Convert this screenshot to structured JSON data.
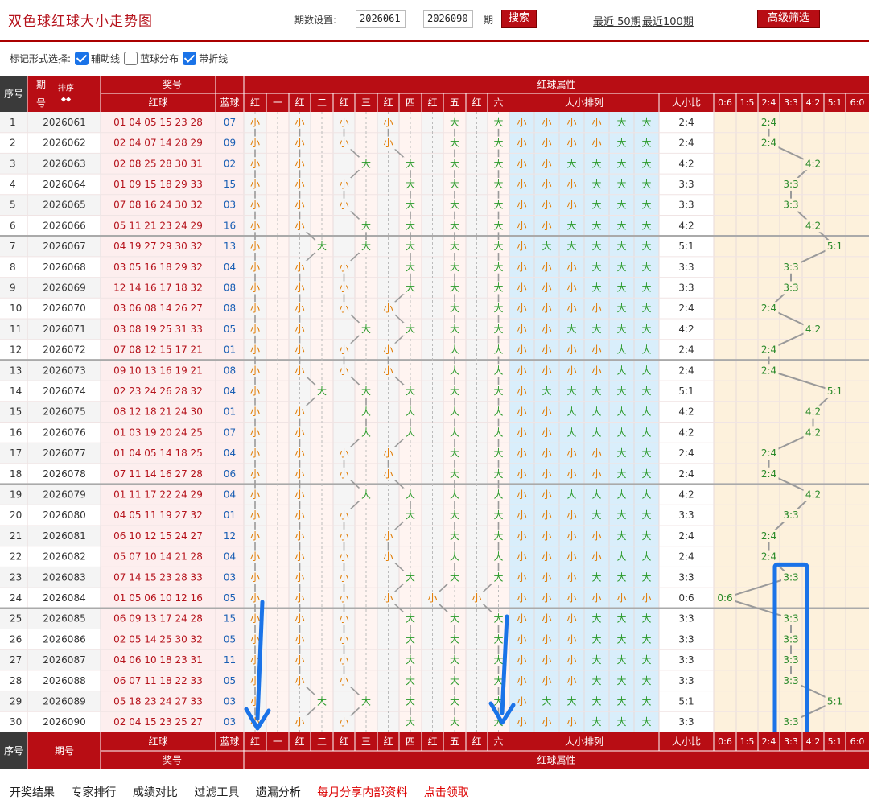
{
  "page_title": "双色球红球大小走势图",
  "controls": {
    "period_label": "期数设置:",
    "start_period": "2026061",
    "separator": "-",
    "end_period": "2026090",
    "period_unit": "期",
    "search_button": "搜索",
    "recent50_link": "最近 50期",
    "recent100_link": "最近100期",
    "advanced_button": "高级筛选"
  },
  "mark_options": {
    "label": "标记形式选择:",
    "options": [
      {
        "label": "辅助线",
        "checked": true
      },
      {
        "label": "蓝球分布",
        "checked": false
      },
      {
        "label": "带折线",
        "checked": true
      }
    ]
  },
  "header": {
    "seq": "序号",
    "period": "期号",
    "period_top": "期",
    "period_bottom": "号",
    "sort_label": "排序",
    "sort_arrows": "◆◆",
    "award": "奖号",
    "red": "红球",
    "blue": "蓝球",
    "red_attr": "红球属性",
    "pos_labels": [
      "红",
      "一",
      "红",
      "二",
      "红",
      "三",
      "红",
      "四",
      "红",
      "五",
      "红",
      "六"
    ],
    "dxpl": "大小排列",
    "ratio": "大小比",
    "ratio_cols": [
      "0:6",
      "1:5",
      "2:4",
      "3:3",
      "4:2",
      "5:1",
      "6:0"
    ]
  },
  "rows": [
    {
      "seq": "1",
      "period": "2026061",
      "reds": "01 04 05 15 23 28",
      "blue": "07"
    },
    {
      "seq": "2",
      "period": "2026062",
      "reds": "02 04 07 14 28 29",
      "blue": "09"
    },
    {
      "seq": "3",
      "period": "2026063",
      "reds": "02 08 25 28 30 31",
      "blue": "02"
    },
    {
      "seq": "4",
      "period": "2026064",
      "reds": "01 09 15 18 29 33",
      "blue": "15"
    },
    {
      "seq": "5",
      "period": "2026065",
      "reds": "07 08 16 24 30 32",
      "blue": "03"
    },
    {
      "seq": "6",
      "period": "2026066",
      "reds": "05 11 21 23 24 29",
      "blue": "16"
    },
    {
      "seq": "7",
      "period": "2026067",
      "reds": "04 19 27 29 30 32",
      "blue": "13"
    },
    {
      "seq": "8",
      "period": "2026068",
      "reds": "03 05 16 18 29 32",
      "blue": "04"
    },
    {
      "seq": "9",
      "period": "2026069",
      "reds": "12 14 16 17 18 32",
      "blue": "08"
    },
    {
      "seq": "10",
      "period": "2026070",
      "reds": "03 06 08 14 26 27",
      "blue": "08"
    },
    {
      "seq": "11",
      "period": "2026071",
      "reds": "03 08 19 25 31 33",
      "blue": "05"
    },
    {
      "seq": "12",
      "period": "2026072",
      "reds": "07 08 12 15 17 21",
      "blue": "01"
    },
    {
      "seq": "13",
      "period": "2026073",
      "reds": "09 10 13 16 19 21",
      "blue": "08"
    },
    {
      "seq": "14",
      "period": "2026074",
      "reds": "02 23 24 26 28 32",
      "blue": "04"
    },
    {
      "seq": "15",
      "period": "2026075",
      "reds": "08 12 18 21 24 30",
      "blue": "01"
    },
    {
      "seq": "16",
      "period": "2026076",
      "reds": "01 03 19 20 24 25",
      "blue": "07"
    },
    {
      "seq": "17",
      "period": "2026077",
      "reds": "01 04 05 14 18 25",
      "blue": "04"
    },
    {
      "seq": "18",
      "period": "2026078",
      "reds": "07 11 14 16 27 28",
      "blue": "06"
    },
    {
      "seq": "19",
      "period": "2026079",
      "reds": "01 11 17 22 24 29",
      "blue": "04"
    },
    {
      "seq": "20",
      "period": "2026080",
      "reds": "04 05 11 19 27 32",
      "blue": "01"
    },
    {
      "seq": "21",
      "period": "2026081",
      "reds": "06 10 12 15 24 27",
      "blue": "12"
    },
    {
      "seq": "22",
      "period": "2026082",
      "reds": "05 07 10 14 21 28",
      "blue": "04"
    },
    {
      "seq": "23",
      "period": "2026083",
      "reds": "07 14 15 23 28 33",
      "blue": "03"
    },
    {
      "seq": "24",
      "period": "2026084",
      "reds": "01 05 06 10 12 16",
      "blue": "05"
    },
    {
      "seq": "25",
      "period": "2026085",
      "reds": "06 09 13 17 24 28",
      "blue": "15"
    },
    {
      "seq": "26",
      "period": "2026086",
      "reds": "02 05 14 25 30 32",
      "blue": "05"
    },
    {
      "seq": "27",
      "period": "2026087",
      "reds": "04 06 10 18 23 31",
      "blue": "11"
    },
    {
      "seq": "28",
      "period": "2026088",
      "reds": "06 07 11 18 22 33",
      "blue": "05"
    },
    {
      "seq": "29",
      "period": "2026089",
      "reds": "05 18 23 24 27 33",
      "blue": "03"
    },
    {
      "seq": "30",
      "period": "2026090",
      "reds": "02 04 15 23 25 27",
      "blue": "03"
    }
  ],
  "size_labels": {
    "small": "小",
    "big": "大"
  },
  "bottom_links": [
    "开奖结果",
    "专家排行",
    "成绩对比",
    "过滤工具",
    "遗漏分析",
    "每月分享内部资料",
    "点击领取"
  ],
  "colors": {
    "brand_red": "#b80d14",
    "small_color": "#e07a00",
    "big_color": "#2a9a2a",
    "highlight_blue": "#1a73e8"
  }
}
